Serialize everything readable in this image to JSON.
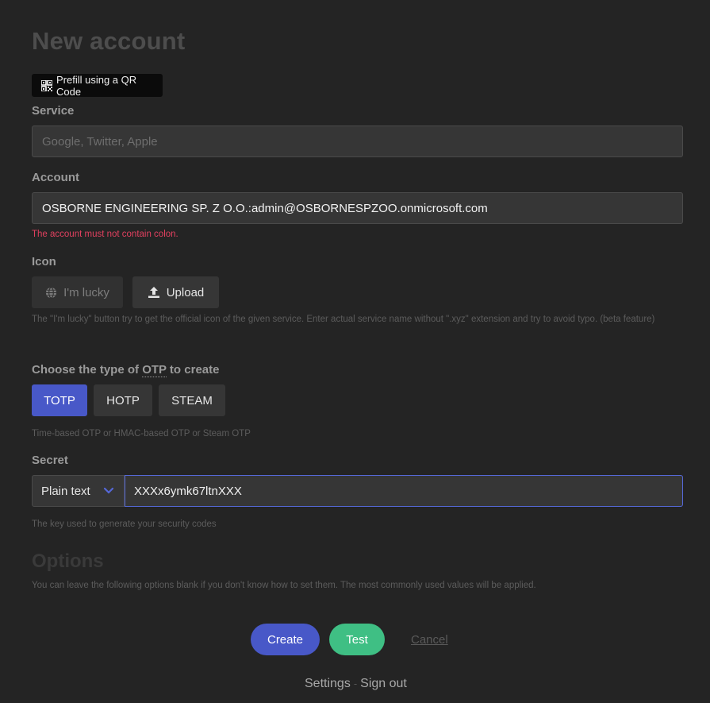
{
  "page": {
    "title": "New account"
  },
  "qr": {
    "label": "Prefill using a QR Code",
    "icon": "qr-code-icon"
  },
  "service": {
    "label": "Service",
    "placeholder": "Google, Twitter, Apple",
    "value": ""
  },
  "account": {
    "label": "Account",
    "value": "OSBORNE ENGINEERING SP. Z O.O.:admin@OSBORNESPZOO.onmicrosoft.com",
    "error": "The account must not contain colon."
  },
  "icon_section": {
    "label": "Icon",
    "lucky_label": "I'm lucky",
    "lucky_icon": "globe-icon",
    "upload_label": "Upload",
    "upload_icon": "upload-icon",
    "help": "The \"I'm lucky\" button try to get the official icon of the given service. Enter actual service name without \".xyz\" extension and try to avoid typo. (beta feature)"
  },
  "otp": {
    "label_prefix": "Choose the type of ",
    "label_abbr": "OTP",
    "label_suffix": " to create",
    "types": [
      "TOTP",
      "HOTP",
      "STEAM"
    ],
    "selected": "TOTP",
    "help": "Time-based OTP or HMAC-based OTP or Steam OTP"
  },
  "secret": {
    "label": "Secret",
    "format": "Plain text",
    "value": "XXXx6ymk67ltnXXX",
    "help": "The key used to generate your security codes"
  },
  "options": {
    "title": "Options",
    "help": "You can leave the following options blank if you don't know how to set them. The most commonly used values will be applied."
  },
  "actions": {
    "create": "Create",
    "test": "Test",
    "cancel": "Cancel"
  },
  "footer": {
    "settings": "Settings",
    "separator": "-",
    "signout": "Sign out"
  },
  "colors": {
    "primary": "#4858c8",
    "test": "#3fbf84",
    "error": "#e0405f"
  }
}
